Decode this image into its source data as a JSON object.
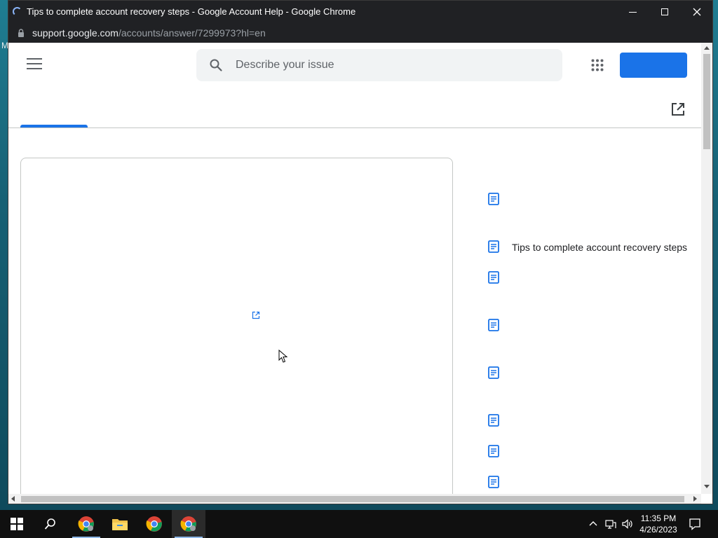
{
  "window": {
    "title": "Tips to complete account recovery steps - Google Account Help - Google Chrome",
    "url_host": "support.google.com",
    "url_path": "/accounts/answer/7299973?hl=en"
  },
  "desktop": {
    "edge_glyph": "M"
  },
  "page": {
    "search_placeholder": "Describe your issue",
    "signin_label": "",
    "related_articles": [
      {
        "label": ""
      },
      {
        "label": "Tips to complete account recovery steps"
      },
      {
        "label": ""
      },
      {
        "label": ""
      },
      {
        "label": ""
      },
      {
        "label": ""
      },
      {
        "label": ""
      },
      {
        "label": ""
      }
    ]
  },
  "taskbar": {
    "time": "11:35 PM",
    "date": "4/26/2023"
  },
  "colors": {
    "accent": "#1a73e8",
    "titlebar": "#202124",
    "taskbar": "#101010"
  },
  "icons": {
    "menu": "hamburger-icon",
    "search": "search-icon",
    "apps": "apps-grid-icon",
    "external": "external-link-icon",
    "article": "article-icon"
  }
}
